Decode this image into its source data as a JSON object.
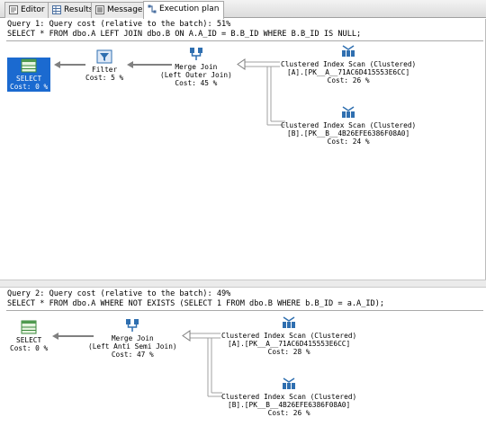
{
  "tabs": [
    {
      "label": "Editor",
      "icon": "editor-icon"
    },
    {
      "label": "Results",
      "icon": "grid-icon"
    },
    {
      "label": "Messages",
      "icon": "messages-icon"
    },
    {
      "label": "Execution plan",
      "icon": "execution-plan-icon"
    }
  ],
  "query1": {
    "header": "Query 1: Query cost (relative to the batch): 51%",
    "sql": "SELECT * FROM dbo.A LEFT JOIN dbo.B ON A.A_ID = B.B_ID WHERE B.B_ID IS NULL;",
    "operators": {
      "select": {
        "name": "SELECT",
        "cost": "Cost: 0 %"
      },
      "filter": {
        "name": "Filter",
        "cost": "Cost: 5 %"
      },
      "merge": {
        "name": "Merge Join",
        "sub": "(Left Outer Join)",
        "cost": "Cost: 45 %"
      },
      "scanA": {
        "name": "Clustered Index Scan (Clustered)",
        "sub": "[A].[PK__A__71AC6D415553E6CC]",
        "cost": "Cost: 26 %"
      },
      "scanB": {
        "name": "Clustered Index Scan (Clustered)",
        "sub": "[B].[PK__B__4B26EFE6386F08A0]",
        "cost": "Cost: 24 %"
      }
    }
  },
  "query2": {
    "header": "Query 2: Query cost (relative to the batch): 49%",
    "sql": "SELECT * FROM dbo.A WHERE NOT EXISTS (SELECT 1 FROM dbo.B WHERE b.B_ID = a.A_ID);",
    "operators": {
      "select": {
        "name": "SELECT",
        "cost": "Cost: 0 %"
      },
      "merge": {
        "name": "Merge Join",
        "sub": "(Left Anti Semi Join)",
        "cost": "Cost: 47 %"
      },
      "scanA": {
        "name": "Clustered Index Scan (Clustered)",
        "sub": "[A].[PK__A__71AC6D415553E6CC]",
        "cost": "Cost: 28 %"
      },
      "scanB": {
        "name": "Clustered Index Scan (Clustered)",
        "sub": "[B].[PK__B__4B26EFE6386F08A0]",
        "cost": "Cost: 26 %"
      }
    }
  },
  "colors": {
    "selected_bg": "#1b6ad0",
    "arrow": "#808080",
    "icon_blue": "#2f6fb0"
  }
}
